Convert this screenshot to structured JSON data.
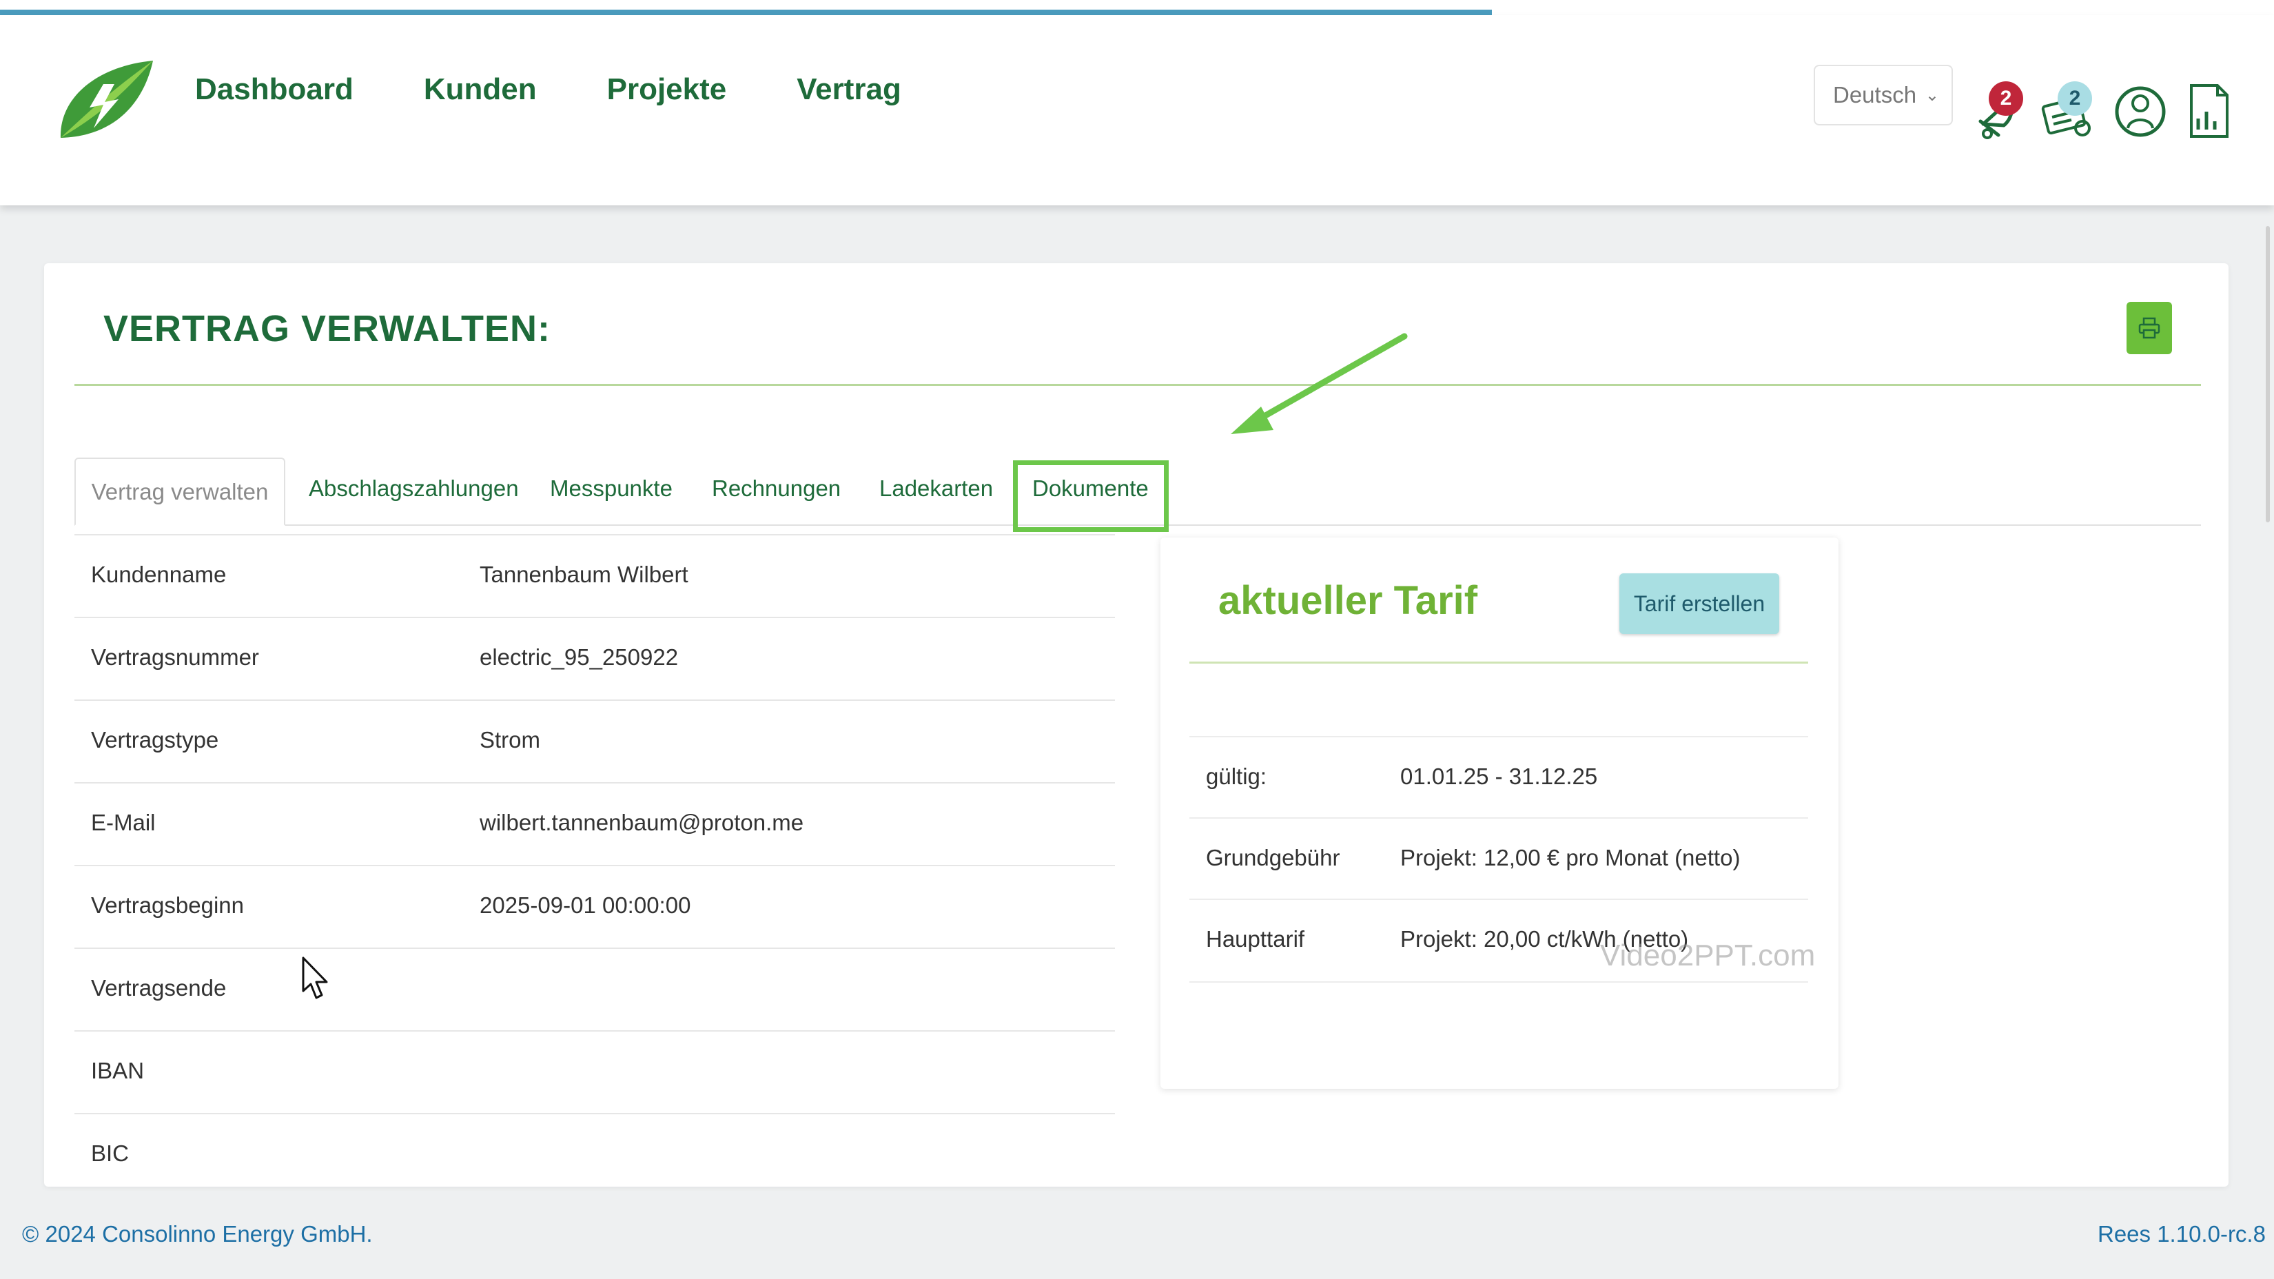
{
  "nav": [
    "Dashboard",
    "Kunden",
    "Projekte",
    "Vertrag"
  ],
  "language": {
    "selected": "Deutsch"
  },
  "notifications": {
    "bell_count": "2",
    "tasks_count": "2"
  },
  "page": {
    "title": "VERTRAG VERWALTEN:"
  },
  "tabs": [
    "Vertrag verwalten",
    "Abschlagszahlungen",
    "Messpunkte",
    "Rechnungen",
    "Ladekarten",
    "Dokumente"
  ],
  "contract_rows": [
    {
      "label": "Kundenname",
      "value": "Tannenbaum Wilbert"
    },
    {
      "label": "Vertragsnummer",
      "value": "electric_95_250922"
    },
    {
      "label": "Vertragstype",
      "value": "Strom"
    },
    {
      "label": "E-Mail",
      "value": "wilbert.tannenbaum@proton.me"
    },
    {
      "label": "Vertragsbeginn",
      "value": "2025-09-01 00:00:00"
    },
    {
      "label": "Vertragsende",
      "value": ""
    },
    {
      "label": "IBAN",
      "value": ""
    },
    {
      "label": "BIC",
      "value": ""
    }
  ],
  "tariff": {
    "title": "aktueller Tarif",
    "button": "Tarif erstellen",
    "rows": [
      {
        "label": "gültig:",
        "value": "01.01.25 - 31.12.25"
      },
      {
        "label": "Grundgebühr",
        "value": "Projekt: 12,00 € pro Monat (netto)"
      },
      {
        "label": "Haupttarif",
        "value": "Projekt: 20,00 ct/kWh (netto)"
      }
    ]
  },
  "watermark": "Video2PPT.com",
  "footer": {
    "copyright": "© 2024 Consolinno Energy GmbH.",
    "version": "Rees 1.10.0-rc.8"
  },
  "colors": {
    "brand_green": "#1e6b3a",
    "accent_green": "#6cc74a",
    "tariff_green": "#6fb236",
    "link_blue": "#1d6fa5",
    "badge_red": "#c0263a",
    "badge_teal": "#5fb7c4"
  },
  "icons": [
    "leaf-logo",
    "bell-icon",
    "task-list-icon",
    "user-icon",
    "document-chart-icon",
    "print-icon"
  ]
}
